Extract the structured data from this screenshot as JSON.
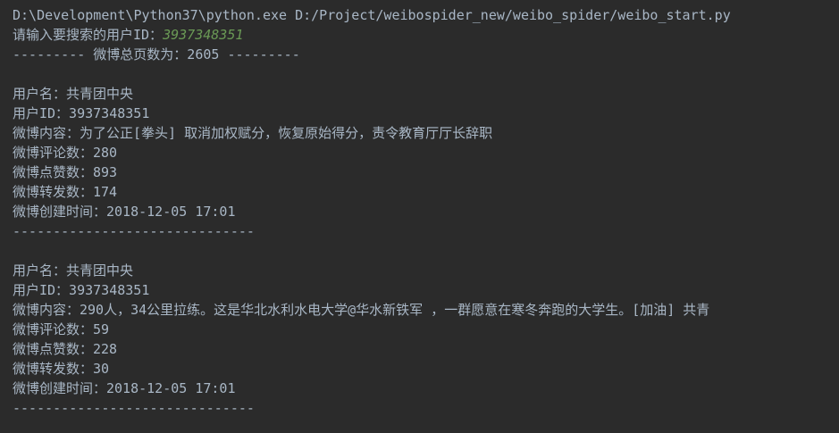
{
  "console": {
    "command_line": "D:\\Development\\Python37\\python.exe D:/Project/weibospider_new/weibo_spider/weibo_start.py",
    "prompt": {
      "label": "请输入要搜索的用户ID：",
      "input_value": "3937348351"
    },
    "total_pages_line": "--------- 微博总页数为：2605 ---------",
    "records": [
      {
        "username_line": "用户名：共青团中央",
        "userid_line": "用户ID：3937348351",
        "content_line": "微博内容：为了公正[拳头] 取消加权赋分，恢复原始得分，责令教育厅厅长辞职",
        "comments_line": "微博评论数：280",
        "likes_line": "微博点赞数：893",
        "reposts_line": "微博转发数：174",
        "created_line": "微博创建时间：2018-12-05 17:01",
        "separator": "------------------------------"
      },
      {
        "username_line": "用户名：共青团中央",
        "userid_line": "用户ID：3937348351",
        "content_line": "微博内容：290人，34公里拉练。这是华北水利水电大学@华水新铁军 ，一群愿意在寒冬奔跑的大学生。[加油] 共青",
        "comments_line": "微博评论数：59",
        "likes_line": "微博点赞数：228",
        "reposts_line": "微博转发数：30",
        "created_line": "微博创建时间：2018-12-05 17:01",
        "separator": "------------------------------"
      }
    ]
  },
  "colors": {
    "background": "#2b2b2b",
    "text": "#a9b7c6",
    "user_input": "#6a9955"
  }
}
